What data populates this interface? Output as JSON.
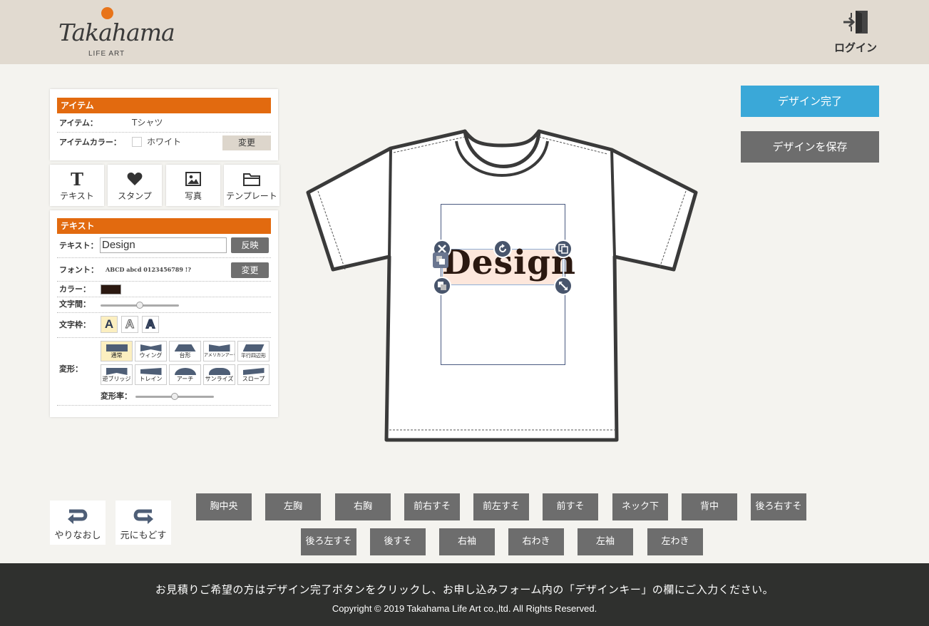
{
  "header": {
    "logo_text": "Takahama",
    "logo_sub": "LIFE ART",
    "login_label": "ログイン"
  },
  "item_panel": {
    "section_title": "アイテム",
    "item_label": "アイテム：",
    "item_value": "Tシャツ",
    "color_label": "アイテムカラー：",
    "color_value": "ホワイト",
    "change_label": "変更"
  },
  "tools": [
    {
      "label": "テキスト",
      "icon": "text-icon"
    },
    {
      "label": "スタンプ",
      "icon": "heart-icon"
    },
    {
      "label": "写真",
      "icon": "image-icon"
    },
    {
      "label": "テンプレート",
      "icon": "folder-icon"
    }
  ],
  "text_panel": {
    "section_title": "テキスト",
    "text_label": "テキスト：",
    "text_value": "Design",
    "apply_label": "反映",
    "font_label": "フォント：",
    "font_sample": "ABCD abcd 0123456789 !?",
    "font_change_label": "変更",
    "color_label": "カラー：",
    "text_color": "#2b1810",
    "spacing_label": "文字間：",
    "spacing_level": 0.5,
    "outline_label": "文字枠：",
    "outline_options": [
      "A",
      "A",
      "A"
    ],
    "deform_label": "変形：",
    "deform_options": [
      "通常",
      "ウィング",
      "台形",
      "アメリカンアーチ",
      "平行四辺形",
      "逆ブリッジ",
      "トレイン",
      "アーチ",
      "サンライズ",
      "スロープ"
    ],
    "deform_rate_label": "変形率：",
    "deform_rate_level": 0.5
  },
  "actions": {
    "complete_label": "デザイン完了",
    "save_label": "デザインを保存",
    "complete_color": "#3aa8d8",
    "save_color": "#6d6d6d"
  },
  "design": {
    "text": "Design"
  },
  "undo_redo": {
    "undo_label": "やりなおし",
    "redo_label": "元にもどす"
  },
  "positions": [
    "胸中央",
    "左胸",
    "右胸",
    "前右すそ",
    "前左すそ",
    "前すそ",
    "ネック下",
    "背中",
    "後ろ右すそ",
    "後ろ左すそ",
    "後すそ",
    "右袖",
    "右わき",
    "左袖",
    "左わき"
  ],
  "footer": {
    "message": "お見積りご希望の方はデザイン完了ボタンをクリックし、お申し込みフォーム内の「デザインキー」の欄にご入力ください。",
    "copyright": "Copyright © 2019 Takahama Life Art co.,ltd. All Rights Reserved."
  }
}
